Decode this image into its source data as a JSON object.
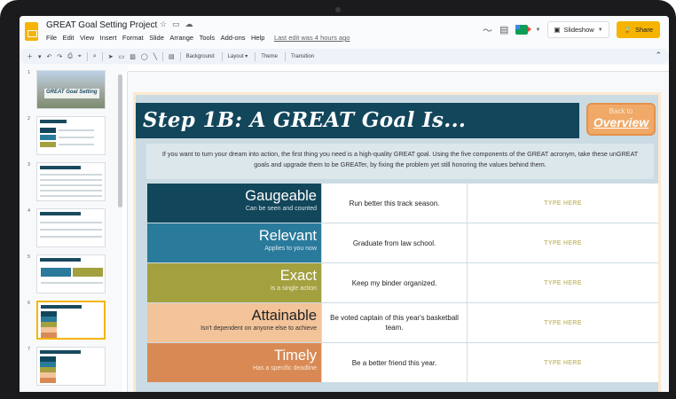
{
  "header": {
    "doc_title": "GREAT Goal Setting Project",
    "menu": [
      "File",
      "Edit",
      "View",
      "Insert",
      "Format",
      "Slide",
      "Arrange",
      "Tools",
      "Add-ons",
      "Help"
    ],
    "last_edit": "Last edit was 4 hours ago",
    "slideshow_label": "Slideshow",
    "share_label": "Share"
  },
  "toolbar": {
    "background": "Background",
    "layout": "Layout ▾",
    "theme": "Theme",
    "transition": "Transition"
  },
  "filmstrip": {
    "numbers": [
      "1",
      "2",
      "3",
      "4",
      "5",
      "6",
      "7"
    ],
    "thumb1_title": "GREAT Goal Setting"
  },
  "slide": {
    "title": "Step 1B: A GREAT Goal Is...",
    "back_line1": "Back to",
    "back_line2": "Overview",
    "intro": "If you want to turn your dream into action, the first thing you need is a high-quality GREAT goal. Using the five components of the GREAT acronym, take these unGREAT goals and upgrade them to be GREATer, by fixing the problem yet still honoring the values behind them.",
    "rows": [
      {
        "label": "Gaugeable",
        "desc": "Can be seen and counted",
        "example": "Run better this track season.",
        "input": "TYPE HERE"
      },
      {
        "label": "Relevant",
        "desc": "Applies to you now",
        "example": "Graduate from law school.",
        "input": "TYPE HERE"
      },
      {
        "label": "Exact",
        "desc": "Is a single action",
        "example": "Keep my binder organized.",
        "input": "TYPE HERE"
      },
      {
        "label": "Attainable",
        "desc": "Isn't dependent on anyone else to achieve",
        "example": "Be voted captain of this year's basketball team.",
        "input": "TYPE HERE"
      },
      {
        "label": "Timely",
        "desc": "Has a specific deadline",
        "example": "Be a better friend this year.",
        "input": "TYPE HERE"
      }
    ]
  },
  "colors": {
    "accent": "#f6b400",
    "title_bar": "#12465b",
    "row_colors": [
      "#12465b",
      "#2a7a9c",
      "#a3a040",
      "#f3c39a",
      "#d98a54"
    ]
  }
}
